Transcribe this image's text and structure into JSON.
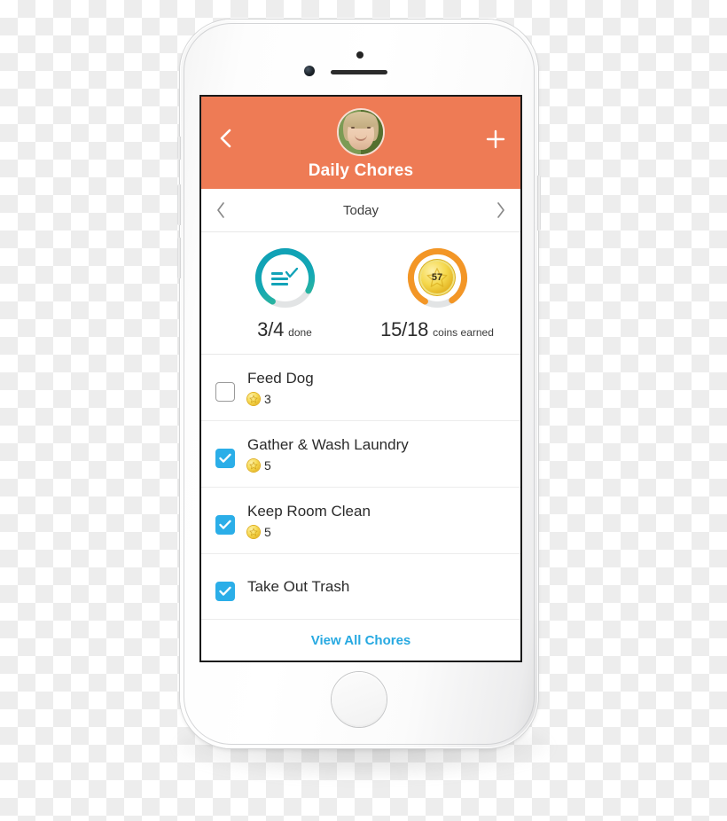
{
  "device": {
    "name": "white-smartphone-mockup",
    "earpiece": "speaker-grille",
    "camera": "front-camera",
    "sensor": "proximity-sensor",
    "home_button": "home-button"
  },
  "header": {
    "title": "Daily Chores",
    "back_icon": "chevron-left-icon",
    "add_icon": "plus-icon",
    "avatar": "user-avatar",
    "background_color": "#EE7B55",
    "text_color": "#FFFFFF"
  },
  "day_nav": {
    "prev_icon": "chevron-left-icon",
    "label": "Today",
    "next_icon": "chevron-right-icon"
  },
  "stats": [
    {
      "id": "chores-done",
      "value": "3/4",
      "unit": "done",
      "icon": "checklist-icon",
      "ring_color": "#12A3B8",
      "ring_color_end": "#3BBD8E",
      "ring_track": "#E2E4E5",
      "percent": 75,
      "completed": 3,
      "total": 4
    },
    {
      "id": "coins-earned",
      "value": "15/18",
      "unit": "coins earned",
      "icon": "coin-icon",
      "coin_number": "57",
      "ring_color": "#F39626",
      "ring_track": "#E2E4E5",
      "percent": 83,
      "completed": 15,
      "total": 18
    }
  ],
  "chores": [
    {
      "title": "Feed Dog",
      "reward": "3",
      "checked": false
    },
    {
      "title": "Gather & Wash Laundry",
      "reward": "5",
      "checked": true
    },
    {
      "title": "Keep Room Clean",
      "reward": "5",
      "checked": true
    },
    {
      "title": "Take Out Trash",
      "reward": "",
      "checked": true
    }
  ],
  "footer": {
    "link_label": "View All Chores",
    "link_color": "#27A9E1"
  },
  "colors": {
    "accent_orange": "#EE7B55",
    "checkbox_blue": "#2BAEE8",
    "teal": "#12A3B8",
    "coin_gold": "#F0C93C"
  }
}
